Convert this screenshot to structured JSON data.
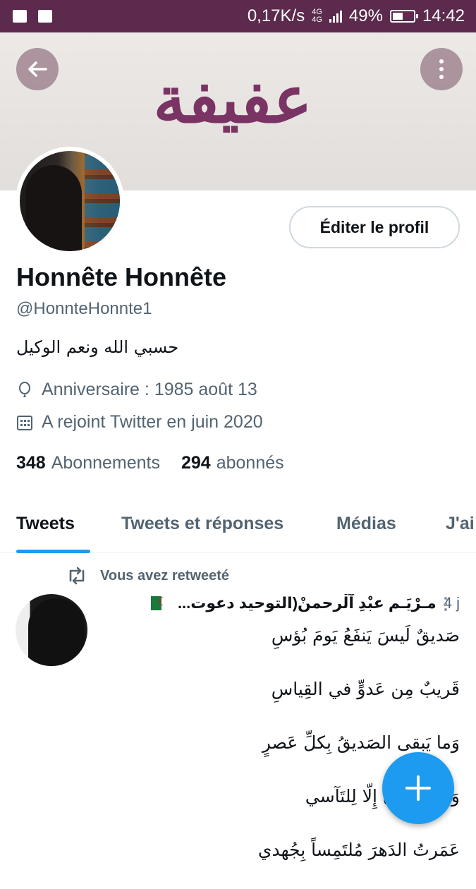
{
  "status_bar": {
    "net_speed": "0,17K/s",
    "network_top": "4G",
    "network_bottom": "4G",
    "battery": "49%",
    "battery_level": 0.49,
    "time": "14:42"
  },
  "banner": {
    "text": "عفيفة"
  },
  "profile": {
    "edit_label": "Éditer le profil",
    "name": "Honnête Honnête",
    "handle": "@HonnteHonnte1",
    "bio": "حسبي الله ونعم الوكيل",
    "birthday": "Anniversaire : 1985 août 13",
    "joined": "A rejoint Twitter en juin 2020",
    "following_count": "348",
    "following_label": "Abonnements",
    "followers_count": "294",
    "followers_label": "abonnés"
  },
  "tabs": [
    "Tweets",
    "Tweets et réponses",
    "Médias",
    "J'ai"
  ],
  "tweet": {
    "retweet_label": "Vous avez retweeté",
    "author": "مـرْيَـم عبْدِ آلْرحمنْ(التوحيد دعوت...",
    "time": "4 j",
    "lines": [
      "صَديقٌ لَيسَ يَنفَعُ يَومَ بُؤسِ",
      "قَريبٌ مِن عَدوٍّ في القِياسِ",
      "وَما يَبقى الصَديقُ بِكلِّ عَصرٍ",
      "وَلا الإِخوانُ إِلّا لِلتَآسي",
      "عَمَرتُ الدَهرَ مُلتَمِساً بِجُهدي"
    ]
  },
  "colors": {
    "status_bar": "#5b2a4c",
    "accent": "#1d9bf0",
    "banner_text": "#7a3464"
  },
  "icons": [
    "mail-icon",
    "image-icon",
    "back-arrow-icon",
    "more-icon",
    "balloon-icon",
    "calendar-icon",
    "retweet-icon",
    "plus-icon"
  ]
}
